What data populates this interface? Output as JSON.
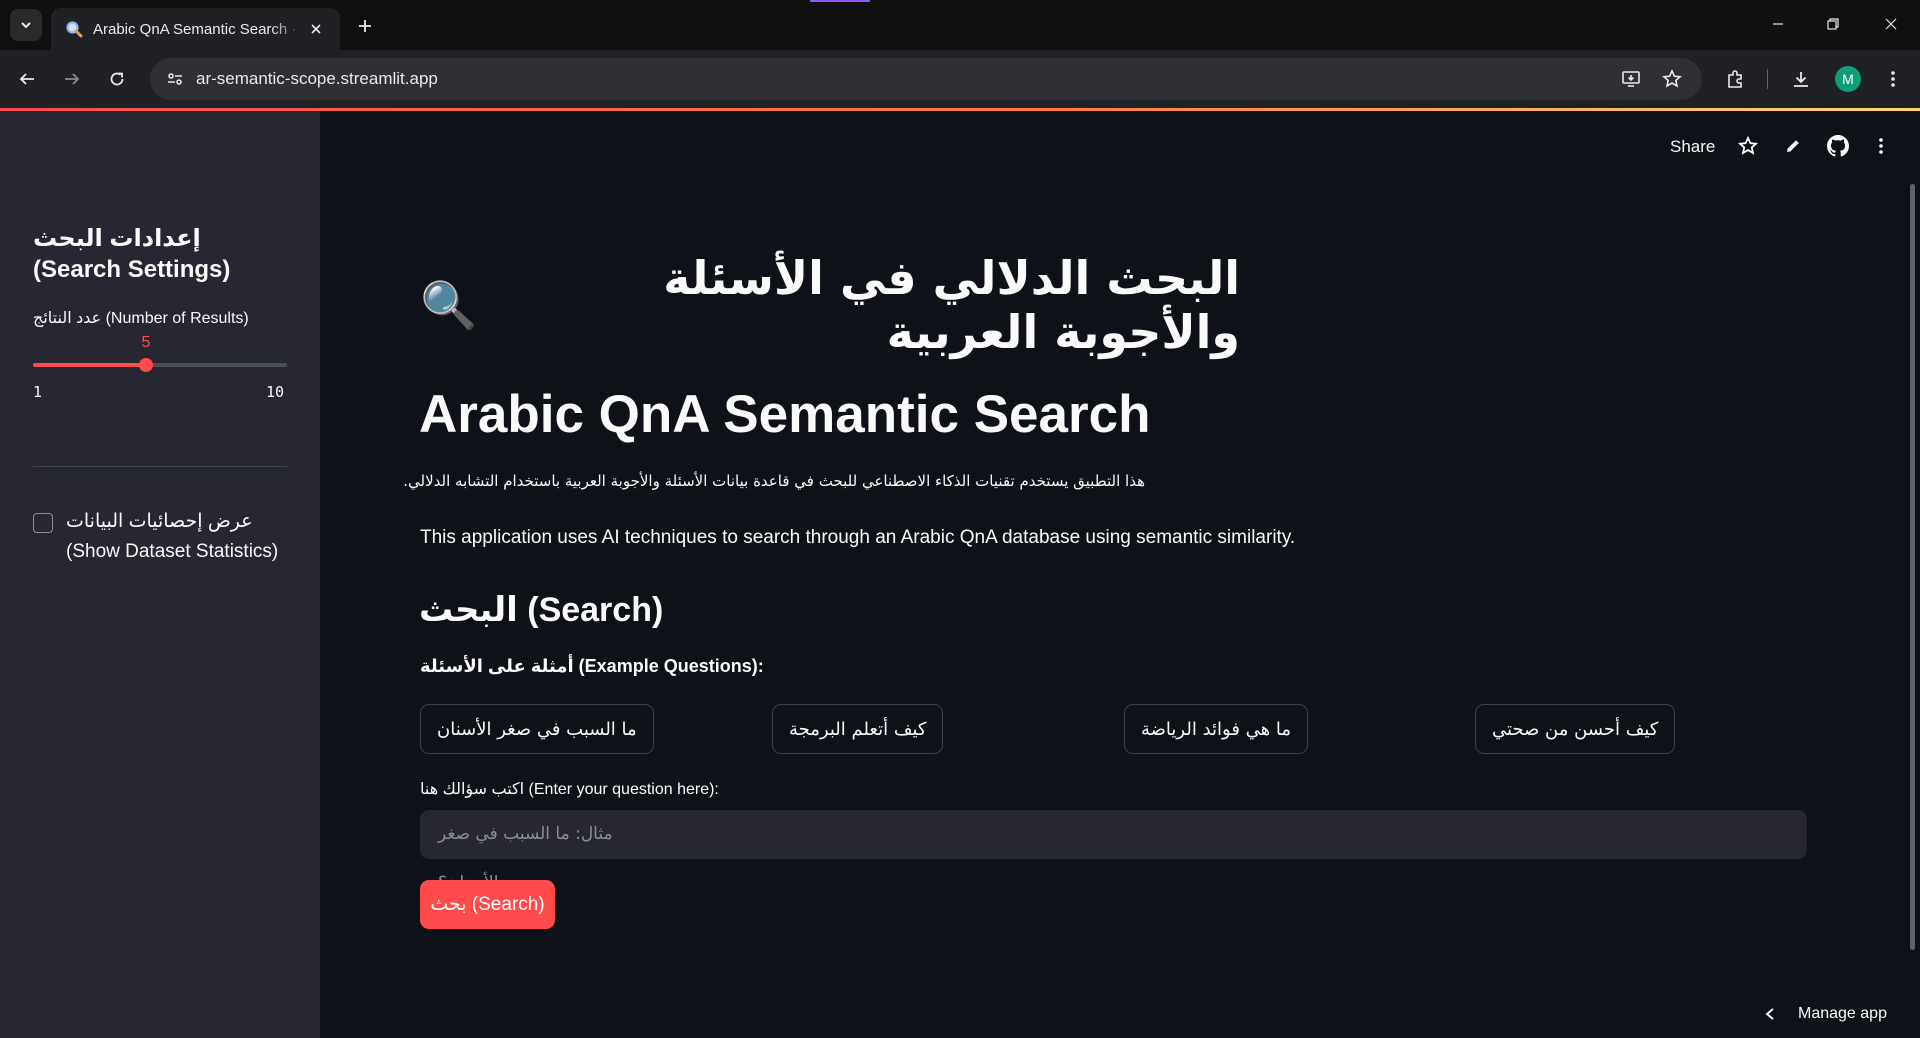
{
  "browser": {
    "tab_title": "Arabic QnA Semantic Search · Streamlit",
    "url": "ar-semantic-scope.streamlit.app",
    "profile_initial": "M",
    "icons": [
      "chevron-down-icon",
      "magnifier-favicon",
      "close-icon",
      "plus-icon",
      "minimize-icon",
      "restore-icon",
      "back-icon",
      "forward-icon",
      "reload-icon",
      "site-info-icon",
      "install-app-icon",
      "bookmark-star-icon",
      "extensions-icon",
      "download-icon",
      "kebab-menu-icon"
    ]
  },
  "app_header": {
    "share_label": "Share",
    "icons": [
      "star-icon",
      "pencil-icon",
      "github-icon",
      "kebab-menu-icon"
    ]
  },
  "sidebar": {
    "title": "إعدادات البحث (Search Settings)",
    "slider": {
      "label": "عدد النتائج (Number of Results)",
      "value": 5,
      "value_text": "5",
      "min": 1,
      "max": 10,
      "min_text": "1",
      "max_text": "10"
    },
    "checkbox": {
      "label": "عرض إحصائيات البيانات (Show Dataset Statistics)",
      "checked": false
    }
  },
  "main": {
    "title_ar": "البحث الدلالي في الأسئلة والأجوبة العربية",
    "title_icon": "🔍",
    "title_en": "Arabic QnA Semantic Search",
    "description_ar": "هذا التطبيق يستخدم تقنيات الذكاء الاصطناعي للبحث في قاعدة بيانات الأسئلة والأجوبة العربية باستخدام التشابه الدلالي.",
    "description_en": "This application uses AI techniques to search through an Arabic QnA database using semantic similarity.",
    "search_heading": "البحث (Search)",
    "examples_label": "أمثلة على الأسئلة (Example Questions):",
    "examples": [
      "ما السبب في صغر الأسنان",
      "كيف أتعلم البرمجة",
      "ما هي فوائد الرياضة",
      "كيف أحسن من صحتي"
    ],
    "input_label": "اكتب سؤالك هنا (Enter your question here):",
    "input_placeholder": "مثال: ما السبب في صغر الأسنان؟",
    "input_value": "",
    "search_button": "بحث (Search)"
  },
  "footer": {
    "manage_app": "Manage app"
  },
  "colors": {
    "primary": "#ff4b4b",
    "background": "#0e1117",
    "sidebar": "#262730",
    "text": "#fafafa"
  }
}
